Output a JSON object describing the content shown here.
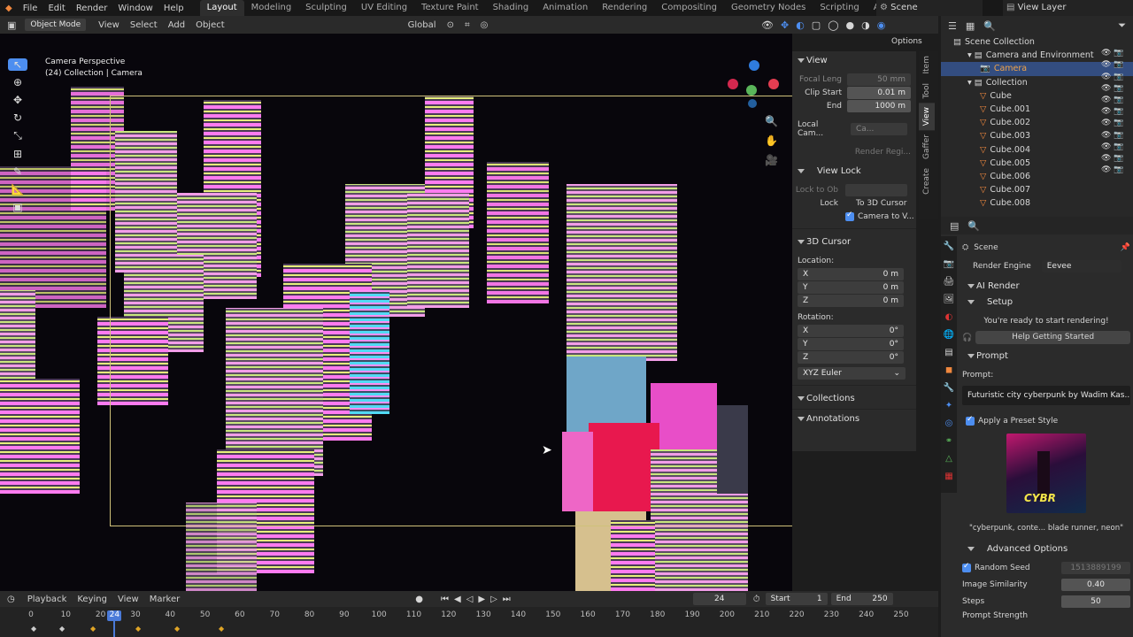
{
  "topbar": {
    "menus": [
      "File",
      "Edit",
      "Render",
      "Window",
      "Help"
    ],
    "workspaces": [
      "Layout",
      "Modeling",
      "Sculpting",
      "UV Editing",
      "Texture Paint",
      "Shading",
      "Animation",
      "Rendering",
      "Compositing",
      "Geometry Nodes",
      "Scripting",
      "AI Render"
    ],
    "active_workspace": "Layout",
    "scene_label": "Scene",
    "view_layer_label": "View Layer"
  },
  "header": {
    "mode": "Object Mode",
    "menus": [
      "View",
      "Select",
      "Add",
      "Object"
    ],
    "orientation": "Global",
    "options": "Options"
  },
  "viewport": {
    "title": "Camera Perspective",
    "subtitle": "(24) Collection | Camera"
  },
  "npanel": {
    "tabs": [
      "Item",
      "Tool",
      "View",
      "Gaffer",
      "Create"
    ],
    "view_header": "View",
    "focal_label": "Focal Leng",
    "focal_value": "50 mm",
    "clip_start_label": "Clip Start",
    "clip_start_value": "0.01 m",
    "end_label": "End",
    "end_value": "1000 m",
    "local_cam_label": "Local Cam...",
    "local_cam_value": "Ca...",
    "render_region": "Render Regi...",
    "view_lock_header": "View Lock",
    "lock_to_ob": "Lock to Ob",
    "lock_label": "Lock",
    "to_3d_cursor": "To 3D Cursor",
    "camera_to_view": "Camera to V...",
    "cursor_header": "3D Cursor",
    "location_label": "Location:",
    "loc": [
      {
        "axis": "X",
        "value": "0 m"
      },
      {
        "axis": "Y",
        "value": "0 m"
      },
      {
        "axis": "Z",
        "value": "0 m"
      }
    ],
    "rotation_label": "Rotation:",
    "rot": [
      {
        "axis": "X",
        "value": "0°"
      },
      {
        "axis": "Y",
        "value": "0°"
      },
      {
        "axis": "Z",
        "value": "0°"
      }
    ],
    "rotation_mode": "XYZ Euler",
    "collections": "Collections",
    "annotations": "Annotations"
  },
  "outliner": {
    "root": "Scene Collection",
    "items": [
      {
        "label": "Camera and Environment",
        "level": 1
      },
      {
        "label": "Camera",
        "level": 2
      },
      {
        "label": "Collection",
        "level": 1
      },
      {
        "label": "Cube",
        "level": 2
      },
      {
        "label": "Cube.001",
        "level": 2
      },
      {
        "label": "Cube.002",
        "level": 2
      },
      {
        "label": "Cube.003",
        "level": 2
      },
      {
        "label": "Cube.004",
        "level": 2
      },
      {
        "label": "Cube.005",
        "level": 2
      },
      {
        "label": "Cube.006",
        "level": 2
      },
      {
        "label": "Cube.007",
        "level": 2
      },
      {
        "label": "Cube.008",
        "level": 2
      }
    ]
  },
  "props": {
    "scene_label": "Scene",
    "render_engine_label": "Render Engine",
    "render_engine_value": "Eevee",
    "ai_render": "AI Render",
    "setup": "Setup",
    "ready_text": "You're ready to start rendering!",
    "help_button": "Help Getting Started",
    "prompt_header": "Prompt",
    "prompt_label": "Prompt:",
    "prompt_value": "Futuristic city cyberpunk by Wadim Kas...",
    "apply_preset": "Apply a Preset Style",
    "preset_caption": "\"cyberpunk, conte... blade runner, neon\"",
    "advanced": "Advanced Options",
    "random_seed": "Random Seed",
    "seed_value": "1513889199",
    "similarity_label": "Image Similarity",
    "similarity_value": "0.40",
    "steps_label": "Steps",
    "steps_value": "50",
    "prompt_strength": "Prompt Strength"
  },
  "timeline": {
    "menus": [
      "Playback",
      "Keying",
      "View",
      "Marker"
    ],
    "current_frame": "24",
    "start_label": "Start",
    "start_value": "1",
    "end_label": "End",
    "end_value": "250",
    "ticks": [
      "0",
      "10",
      "20",
      "24",
      "30",
      "40",
      "50",
      "60",
      "70",
      "80",
      "90",
      "100",
      "110",
      "120",
      "130",
      "140",
      "150",
      "160",
      "170",
      "180",
      "190",
      "200",
      "210",
      "220",
      "230",
      "240",
      "250"
    ]
  },
  "colors": {
    "accent_blue": "#4d8ef0",
    "active_tab": "#2e2e2e",
    "frame_marker": "#4a7ad8",
    "keyframe": "#e0a526"
  }
}
